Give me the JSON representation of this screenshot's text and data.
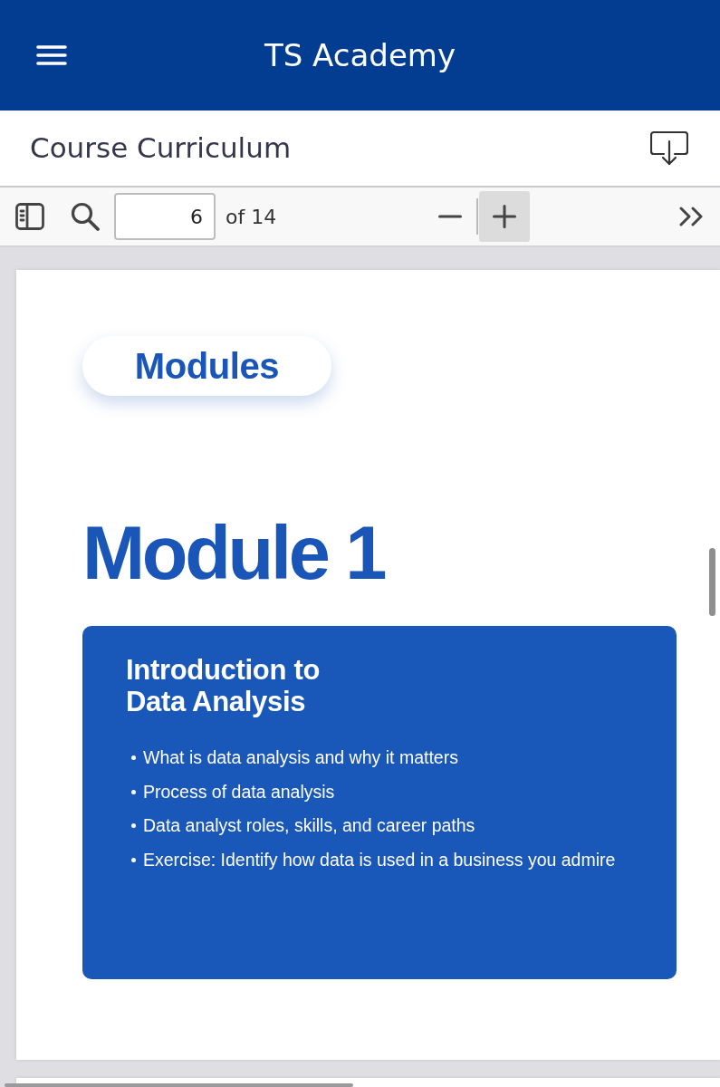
{
  "app_bar": {
    "title": "TS Academy"
  },
  "document_header": {
    "title": "Course Curriculum"
  },
  "viewer_toolbar": {
    "page_field": {
      "value": "6"
    },
    "page_count": "of 14",
    "zoom_out": {
      "highlighted": false
    },
    "zoom_in": {
      "highlighted": true
    }
  },
  "page": {
    "section_label": "Modules",
    "heading": "Module 1",
    "module_card": {
      "title": "Introduction to Data Analysis",
      "topics": [
        "What is data analysis and why it matters",
        "Process of data analysis",
        "Data analyst roles, skills, and career paths",
        "Exercise: Identify how data is used in a business you admire"
      ]
    }
  }
}
